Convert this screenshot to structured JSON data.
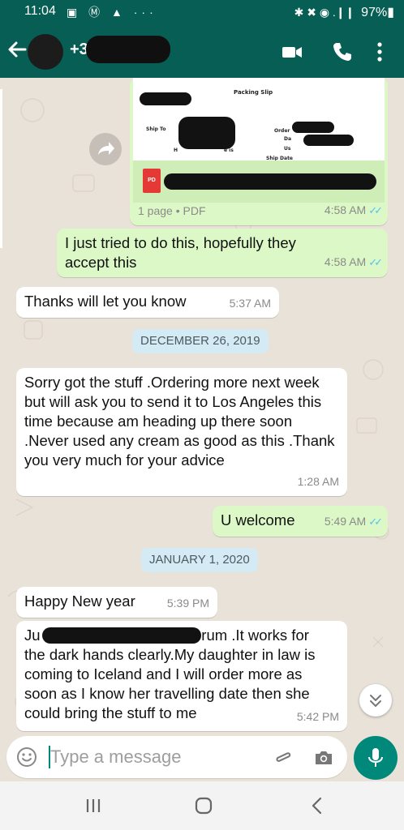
{
  "status_bar": {
    "time": "11:04",
    "left_icons": "▣ Ⓜ ▲ ···",
    "right_icons": "✱ ✖ ◉ .❙❙",
    "battery": "97%▮"
  },
  "header": {
    "contact_name": "+3             51",
    "icons": [
      "back-arrow-icon",
      "video-call-icon",
      "phone-call-icon",
      "more-options-icon"
    ],
    "color": "#075e54"
  },
  "messages": {
    "pdf": {
      "title": "Packing Slip",
      "labels": [
        "Ship To",
        "Order",
        "Da",
        "Us",
        "Ship Date",
        "e is",
        "H"
      ],
      "file_badge": "PD",
      "info": "1 page • PDF",
      "time": "4:58 AM"
    },
    "m1": {
      "text": "I just tried to do this, hopefully they accept this",
      "time": "4:58 AM"
    },
    "m2": {
      "text": "Thanks will let you know",
      "time": "5:37 AM"
    },
    "date1": "DECEMBER 26, 2019",
    "m3": {
      "text": "Sorry got the stuff .Ordering more next week but will ask you to send it to Los Angeles this time because am heading up there soon .Never used any cream as good as this .Thank you very much for your advice",
      "time": "1:28 AM"
    },
    "m4": {
      "text": "U welcome",
      "time": "5:49 AM"
    },
    "date2": "JANUARY 1, 2020",
    "m5": {
      "text": "Happy New year",
      "time": "5:39 PM"
    },
    "m6": {
      "first_line_start": "Ju",
      "first_line_end": "erum .It works for",
      "rest": "the dark hands clearly.My daughter in law is coming to Iceland and I will order more as soon as I know her travelling date then she could bring the stuff to me",
      "time": "5:42 PM"
    }
  },
  "composer": {
    "placeholder": "Type a message"
  },
  "colors": {
    "header": "#075e54",
    "outgoing_bubble": "#dcf8c6",
    "incoming_bubble": "#ffffff",
    "read_ticks": "#4fc3f7",
    "accent": "#00897b",
    "date_chip": "#d4eaf4",
    "wallpaper": "#e9e2d8"
  }
}
